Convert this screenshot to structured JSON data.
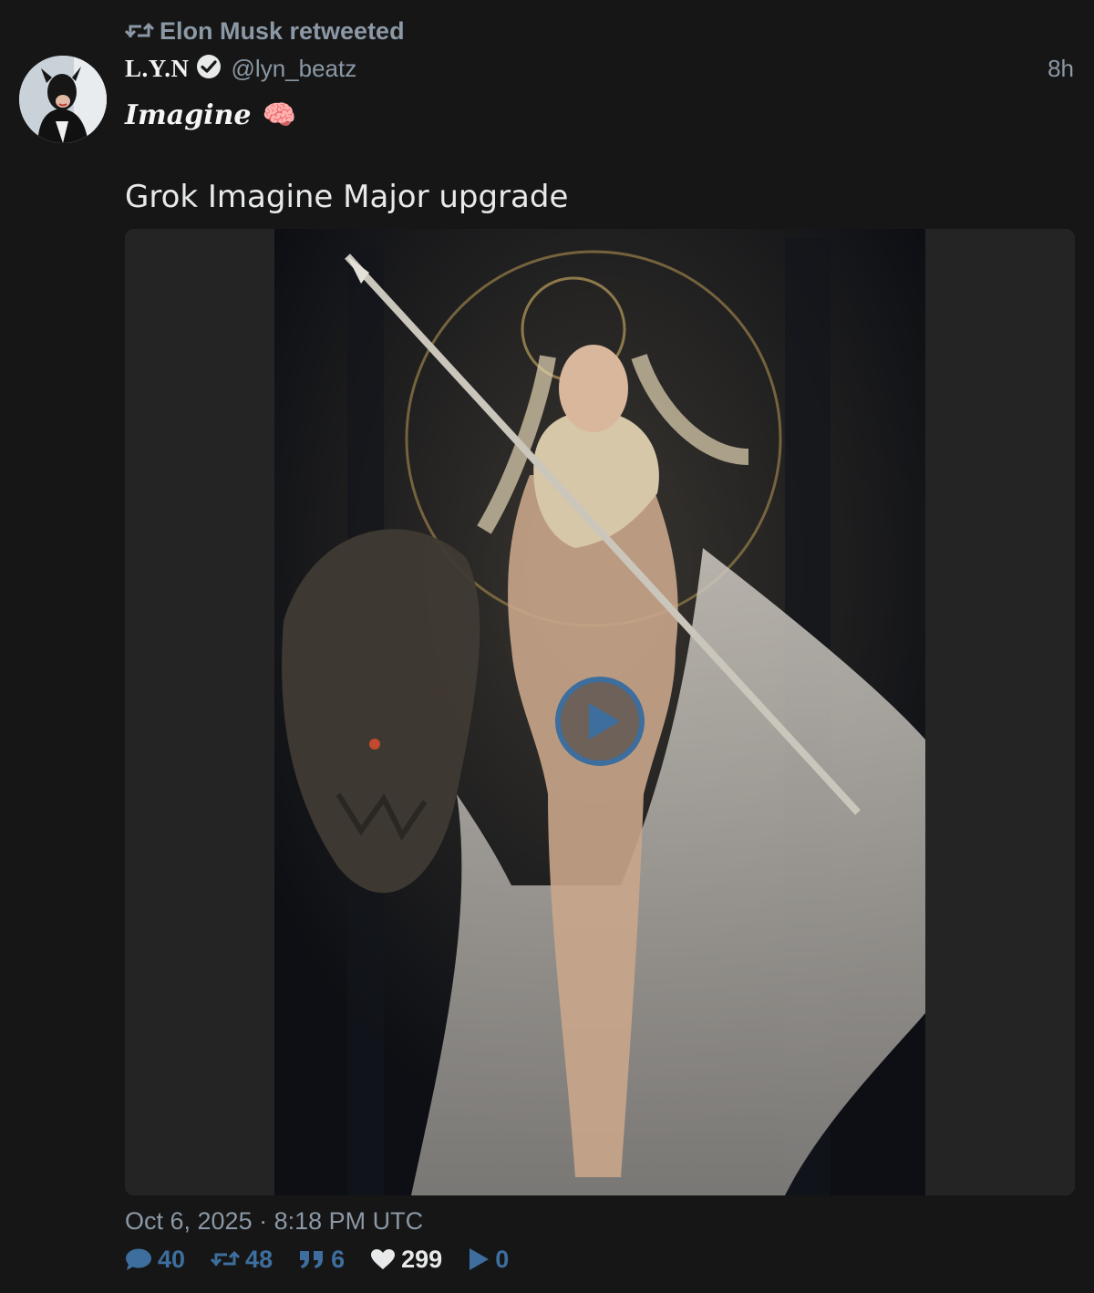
{
  "retweet": {
    "text": "Elon Musk retweeted"
  },
  "tweet": {
    "display_name": "L.Y.N",
    "handle": "@lyn_beatz",
    "time_ago": "8h",
    "bio_word": "Imagine",
    "bio_emoji": "🧠",
    "text": "Grok Imagine Major upgrade",
    "timestamp": "Oct 6, 2025 · 8:18 PM UTC"
  },
  "stats": {
    "replies": "40",
    "retweets": "48",
    "quotes": "6",
    "likes": "299",
    "views": "0"
  },
  "colors": {
    "background": "#161616",
    "muted": "#8b98a5",
    "accent": "#3d6e9e"
  },
  "icons": {
    "retweet": "retweet-icon",
    "verified": "verified-check-icon",
    "reply": "comment-icon",
    "quote": "quote-icon",
    "like": "heart-icon",
    "views": "play-icon"
  }
}
